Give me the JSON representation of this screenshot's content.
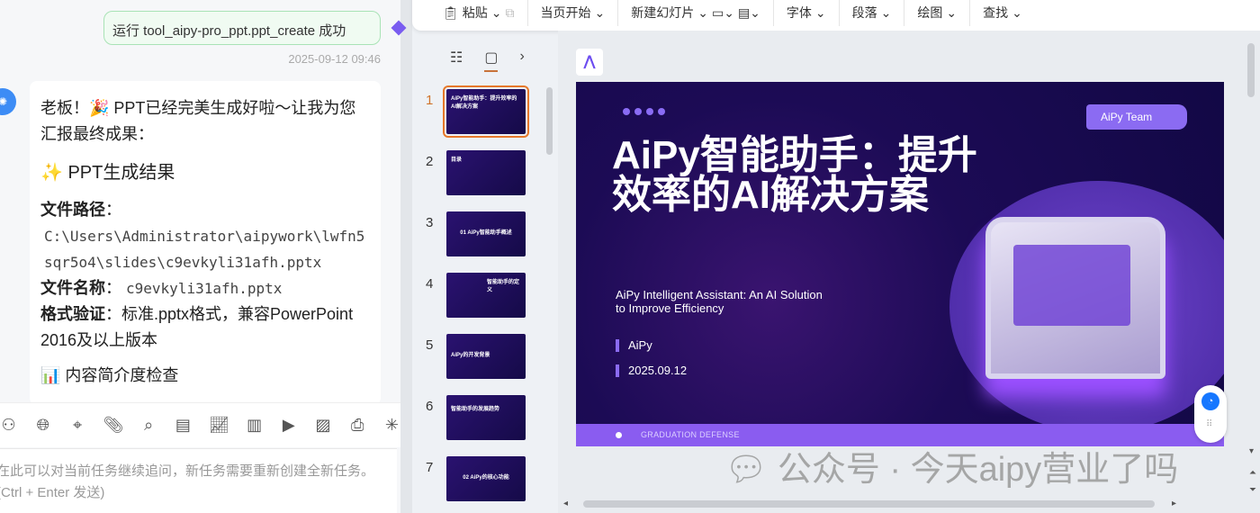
{
  "chat": {
    "user_message": "运行 tool_aipy-pro_ppt.ppt_create 成功",
    "timestamp": "2025-09-12 09:46",
    "assistant": {
      "line1": "老板！🎉 PPT已经完美生成好啦～让我为您汇报最终成果：",
      "heading": "✨ PPT生成结果",
      "path_label": "文件路径",
      "path_value": "C:\\Users\\Administrator\\aipywork\\lwfn5sqr5o4\\slides\\c9evkyli31afh.pptx",
      "name_label": "文件名称",
      "name_value": "c9evkyli31afh.pptx",
      "format_label": "格式验证",
      "format_value": "标准.pptx格式，兼容PowerPoint 2016及以上版本",
      "next_heading": "📊 内容简介度检查"
    },
    "input_placeholder_1": "在此可以对当前任务继续追问，新任务需要重新创建全新任务。",
    "input_placeholder_2": "(Ctrl + Enter 发送)"
  },
  "toolbar": {
    "paste": "粘贴",
    "start_from_current": "当页开始",
    "new_slide": "新建幻灯片",
    "font": "字体",
    "paragraph": "段落",
    "drawing": "绘图",
    "find": "查找"
  },
  "thumbnails": [
    {
      "num": "1",
      "label": "AiPy智能助手：提升效率的AI解决方案"
    },
    {
      "num": "2",
      "label": "目录"
    },
    {
      "num": "3",
      "label": "01 AiPy智能助手概述"
    },
    {
      "num": "4",
      "label": "智能助手的定义"
    },
    {
      "num": "5",
      "label": "AiPy的开发背景"
    },
    {
      "num": "6",
      "label": "智能助手的发展趋势"
    },
    {
      "num": "7",
      "label": "02 AiPy的核心功能"
    }
  ],
  "slide": {
    "team": "AiPy Team",
    "title": "AiPy智能助手：提升效率的AI解决方案",
    "subtitle_1": "AiPy Intelligent Assistant: An AI Solution",
    "subtitle_2": "to Improve Efficiency",
    "author": "AiPy",
    "date": "2025.09.12",
    "footer": "GRADUATION   DEFENSE"
  },
  "watermark": "公众号 · 今天aipy营业了吗"
}
